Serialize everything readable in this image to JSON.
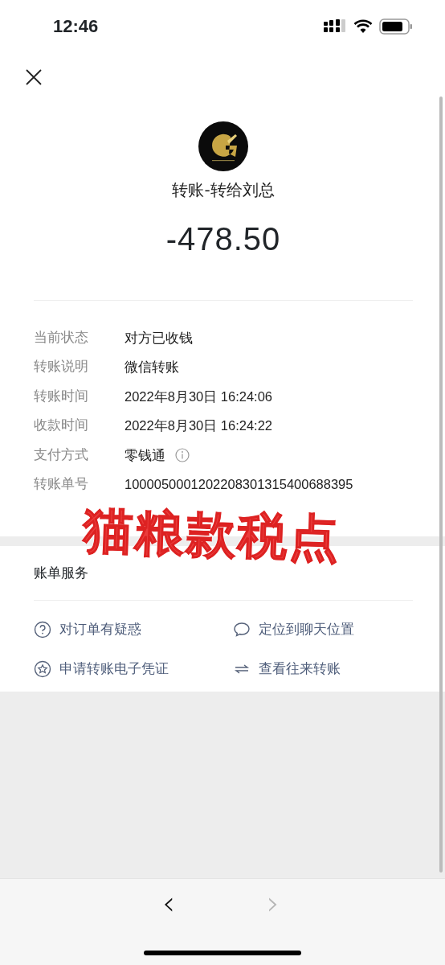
{
  "status_bar": {
    "time": "12:46"
  },
  "header": {
    "title": "转账-转给刘总",
    "amount": "-478.50"
  },
  "details": [
    {
      "label": "当前状态",
      "value": "对方已收钱"
    },
    {
      "label": "转账说明",
      "value": "微信转账"
    },
    {
      "label": "转账时间",
      "value": "2022年8月30日 16:24:06"
    },
    {
      "label": "收款时间",
      "value": "2022年8月30日 16:24:22"
    },
    {
      "label": "支付方式",
      "value": "零钱通",
      "info": true
    },
    {
      "label": "转账单号",
      "value": "1000050001202208301315400688395"
    }
  ],
  "services": {
    "title": "账单服务",
    "items": [
      {
        "kind": "question",
        "label": "对订单有疑惑"
      },
      {
        "kind": "chat",
        "label": "定位到聊天位置"
      },
      {
        "kind": "star",
        "label": "申请转账电子凭证"
      },
      {
        "kind": "swap",
        "label": "查看往来转账"
      }
    ]
  },
  "annotation": "猫粮款税点",
  "toolbar": {
    "back": {
      "label": "‹",
      "disabled": false
    },
    "forward": {
      "label": "›",
      "disabled": true
    }
  }
}
